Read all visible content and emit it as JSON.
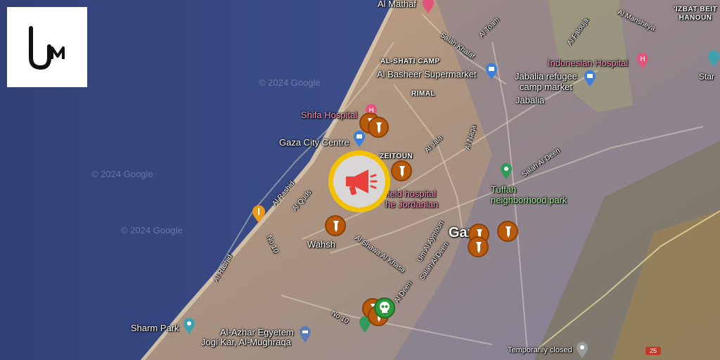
{
  "labels": {
    "al_mathaf": "Al Mathaf",
    "izbat_beit_hanoun": "'IZBAT BEIT\nHANOUN",
    "salah_khalaf": "Salah Khalaf",
    "al_toam": "Al Toam",
    "al_falouja": "Al Falouja",
    "al_mansheya": "Al Mansheya",
    "al_shati_camp": "AL-SHATI CAMP",
    "indonesian_hospital": "Indonesian Hospital",
    "al_basheer": "Al Basheer Supermarket",
    "jabalia_market_1": "Jabalia refugee",
    "jabalia_market_2": "camp market",
    "rimal": "RIMAL",
    "jabalia": "Jabalia",
    "shifa": "Shifa Hospital",
    "gaza_city_centre": "Gaza City Centre",
    "zeitoun": "ZEITOUN",
    "al_jala": "Al Jala",
    "al_naqa": "Al Naqa",
    "salah_al_deen_ne": "Salah Al Deen",
    "field_hospital_1": "field hospital",
    "field_hospital_2": "he Jordanian",
    "tuffah_1": "Tuffah",
    "tuffah_2": "neighborhood park",
    "al_rashid_1": "Al Rashid",
    "al_quds": "Al Quds",
    "wahsh": "Wahsh",
    "no10_a": "No 10",
    "um_alaymoun": "Um Al Aymoun",
    "gaza": "Gaza",
    "al_shawa": "Al Shawa Al Khasa",
    "salah_al_deen_mid": "Salah Al Deen",
    "al_rashid_2": "Al Rashid",
    "al_deen": "Al Deen",
    "no10_b": "No 10",
    "sharm_park": "Sharm Park",
    "al_azhar": "Al-Azhar Egyetem",
    "jogi_kar": "Jogi Kar, Al-Mughraqa",
    "temporarily_closed": "Temporarily closed",
    "road_25": "25",
    "star": "Star"
  },
  "watermarks": [
    "© 2024 Google",
    "© 2024 Google",
    "© 2024 Google"
  ],
  "colors": {
    "sea": "#3b4a86",
    "land": "#b99572",
    "marker": "#b85a0c",
    "highlight_ring": "#f2c200",
    "megaphone": "#e8403a",
    "skull_marker": "#2f9a3e"
  },
  "icons": [
    "megaphone-icon",
    "bomb-icon",
    "skull-icon",
    "hospital-pin-icon",
    "shopping-bag-icon",
    "park-pin-icon",
    "restaurant-pin-icon",
    "school-pin-icon",
    "location-pin-icon"
  ]
}
